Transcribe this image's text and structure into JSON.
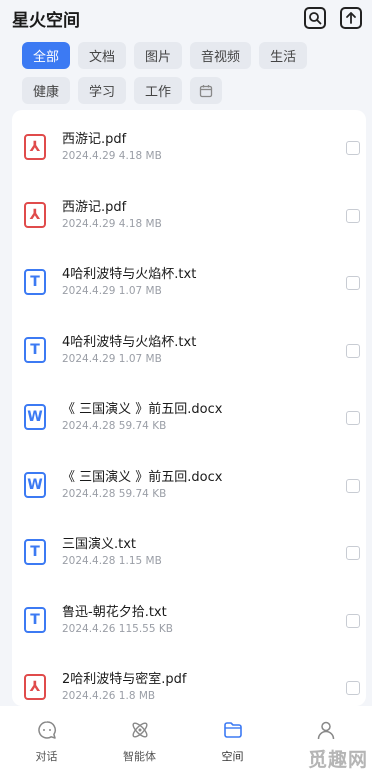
{
  "header": {
    "title": "星火空间",
    "search_icon": "search-icon",
    "upload_icon": "upload-icon"
  },
  "filters": {
    "chips": [
      "全部",
      "文档",
      "图片",
      "音视频",
      "生活",
      "健康",
      "学习",
      "工作"
    ],
    "active_index": 0,
    "calendar_icon": "calendar-icon"
  },
  "files": [
    {
      "name": "西游记.pdf",
      "date": "2024.4.29",
      "size": "4.18 MB",
      "type": "pdf",
      "icon_glyph": "⅄"
    },
    {
      "name": "西游记.pdf",
      "date": "2024.4.29",
      "size": "4.18 MB",
      "type": "pdf",
      "icon_glyph": "⅄"
    },
    {
      "name": "4哈利波特与火焰杯.txt",
      "date": "2024.4.29",
      "size": "1.07 MB",
      "type": "txt",
      "icon_glyph": "T"
    },
    {
      "name": "4哈利波特与火焰杯.txt",
      "date": "2024.4.29",
      "size": "1.07 MB",
      "type": "txt",
      "icon_glyph": "T"
    },
    {
      "name": "《 三国演义 》前五回.docx",
      "date": "2024.4.28",
      "size": "59.74 KB",
      "type": "doc",
      "icon_glyph": "W"
    },
    {
      "name": "《 三国演义 》前五回.docx",
      "date": "2024.4.28",
      "size": "59.74 KB",
      "type": "doc",
      "icon_glyph": "W"
    },
    {
      "name": "三国演义.txt",
      "date": "2024.4.28",
      "size": "1.15 MB",
      "type": "txt",
      "icon_glyph": "T"
    },
    {
      "name": "鲁迅-朝花夕拾.txt",
      "date": "2024.4.26",
      "size": "115.55 KB",
      "type": "txt",
      "icon_glyph": "T"
    },
    {
      "name": "2哈利波特与密室.pdf",
      "date": "2024.4.26",
      "size": "1.8 MB",
      "type": "pdf",
      "icon_glyph": "⅄"
    }
  ],
  "tabbar": {
    "tabs": [
      {
        "label": "对话",
        "icon": "chat-icon"
      },
      {
        "label": "智能体",
        "icon": "atom-icon"
      },
      {
        "label": "空间",
        "icon": "folder-icon"
      },
      {
        "label": "",
        "icon": "profile-icon"
      }
    ],
    "active_index": 2
  },
  "watermark": "觅趣网",
  "colors": {
    "accent": "#3c7af3",
    "pdf": "#e04b4b",
    "background": "#f3f5f9"
  }
}
